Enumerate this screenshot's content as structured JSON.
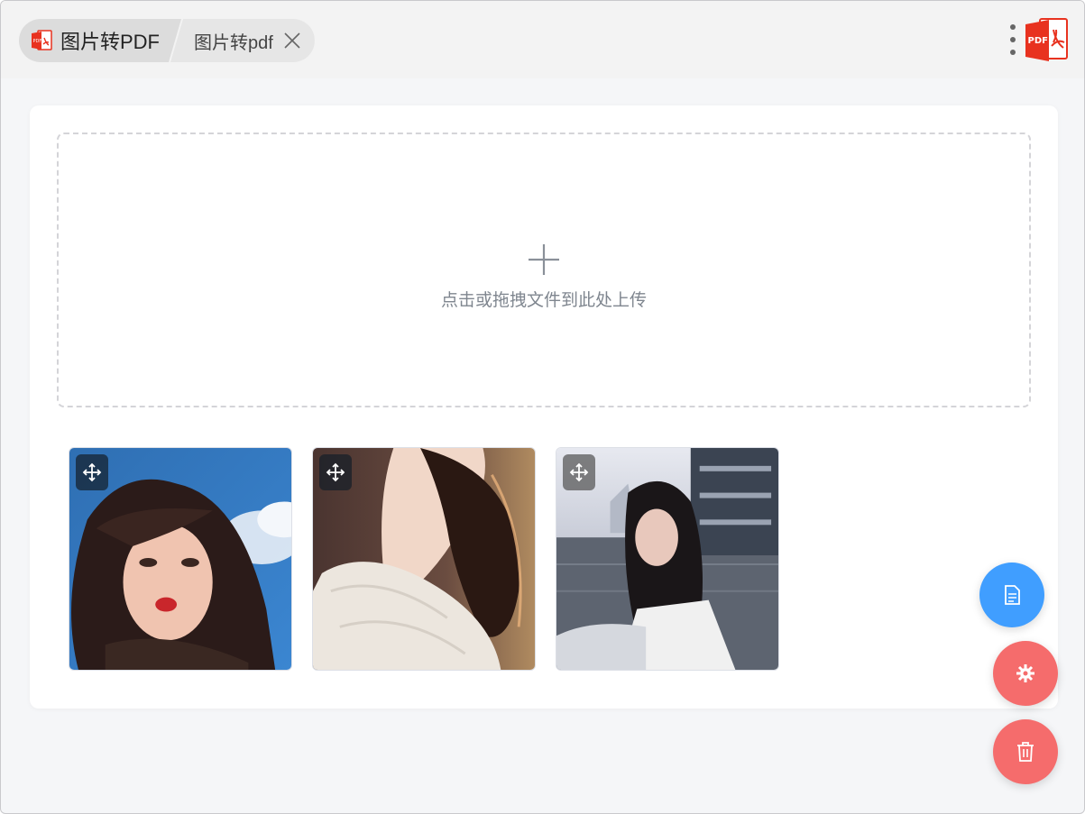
{
  "titlebar": {
    "breadcrumb_home": "图片转PDF",
    "current_tab": "图片转pdf",
    "home_icon": "pdf-file-icon",
    "logo_icon": "pdf-logo-icon",
    "logo_text": "PDF"
  },
  "upload": {
    "hint": "点击或拖拽文件到此处上传",
    "icon": "plus-icon"
  },
  "images": [
    {
      "name": "photo-1",
      "handle_icon": "move-icon"
    },
    {
      "name": "photo-2",
      "handle_icon": "move-icon"
    },
    {
      "name": "photo-3",
      "handle_icon": "move-icon"
    }
  ],
  "fabs": [
    {
      "icon": "document-icon",
      "color": "#409eff"
    },
    {
      "icon": "gear-icon",
      "color": "#f56c6c"
    },
    {
      "icon": "trash-icon",
      "color": "#f56c6c"
    }
  ],
  "colors": {
    "primary": "#409eff",
    "danger": "#f56c6c",
    "pdf_red": "#e8321f"
  }
}
